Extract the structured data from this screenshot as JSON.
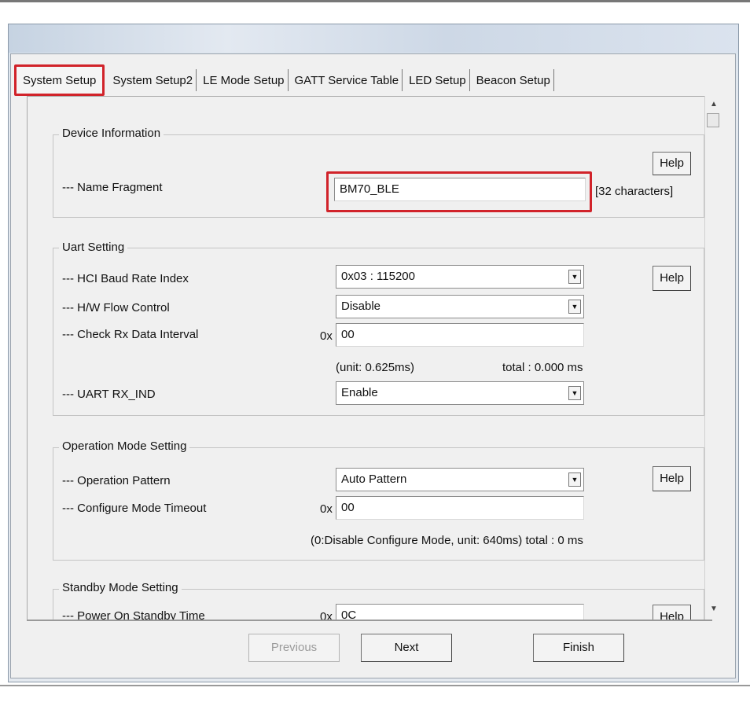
{
  "tabs": [
    {
      "label": "System Setup",
      "active": true
    },
    {
      "label": "System Setup2"
    },
    {
      "label": "LE Mode Setup"
    },
    {
      "label": "GATT Service Table"
    },
    {
      "label": "LED Setup"
    },
    {
      "label": "Beacon Setup"
    }
  ],
  "device_info": {
    "title": "Device Information",
    "name_fragment_label": "--- Name Fragment",
    "name_fragment_value": "BM70_BLE",
    "char_hint": "[32 characters]",
    "help": "Help"
  },
  "uart": {
    "title": "Uart Setting",
    "baud_label": "--- HCI Baud Rate Index",
    "baud_value": "0x03 : 115200",
    "flow_label": "--- H/W Flow Control",
    "flow_value": "Disable",
    "rx_interval_label": "--- Check Rx Data Interval",
    "rx_interval_prefix": "0x",
    "rx_interval_value": "00",
    "unit_text": "(unit: 0.625ms)",
    "total_text": "total : 0.000 ms",
    "rx_ind_label": "--- UART RX_IND",
    "rx_ind_value": "Enable",
    "help": "Help"
  },
  "operation": {
    "title": "Operation Mode Setting",
    "pattern_label": "--- Operation Pattern",
    "pattern_value": "Auto Pattern",
    "timeout_label": "--- Configure Mode Timeout",
    "timeout_prefix": "0x",
    "timeout_value": "00",
    "note": "(0:Disable Configure Mode, unit: 640ms)  total : 0 ms",
    "help": "Help"
  },
  "standby": {
    "title": "Standby Mode Setting",
    "power_on_label": "--- Power On Standby Time",
    "power_on_prefix": "0x",
    "power_on_value": "0C",
    "help": "Help"
  },
  "footer": {
    "previous": "Previous",
    "next": "Next",
    "finish": "Finish"
  },
  "icons": {
    "dropdown": "chevron-down-icon",
    "scroll_up": "arrow-up-icon",
    "scroll_down": "arrow-down-icon"
  },
  "colors": {
    "highlight": "#d1232a"
  }
}
